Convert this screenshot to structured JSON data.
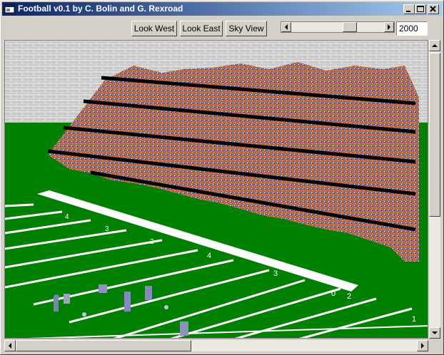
{
  "window": {
    "title": "Football v0.1 by C. Bolin and G. Rexroad"
  },
  "toolbar": {
    "look_west": "Look West",
    "look_east": "Look East",
    "sky_view": "Sky View",
    "year_value": "2000",
    "slider_fraction": 0.64
  },
  "field": {
    "yard_numbers_near": [
      "4",
      "3",
      "2",
      "1"
    ],
    "yard_numbers_far": [
      "4",
      "3",
      "2",
      "1"
    ],
    "yard_number_zero": "0"
  },
  "colors": {
    "title_start": "#0a246a",
    "title_end": "#a6caf0",
    "field_green": "#008000",
    "wall_gray": "#c8c8c8",
    "yard_line_white": "#ffffff"
  }
}
